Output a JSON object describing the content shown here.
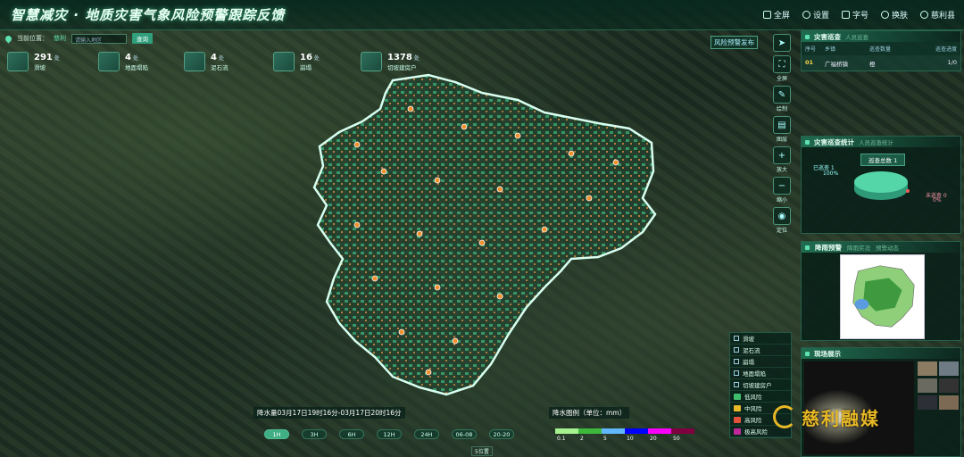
{
  "header": {
    "title": "智慧减灾 · 地质灾害气象风险预警跟踪反馈",
    "menu": [
      {
        "label": "全屏",
        "icon": "fullscreen-icon"
      },
      {
        "label": "设置",
        "icon": "gear-icon"
      },
      {
        "label": "字号",
        "icon": "font-size-icon"
      },
      {
        "label": "换肤",
        "icon": "palette-icon"
      },
      {
        "label": "慈利县",
        "icon": "user-icon"
      }
    ]
  },
  "location": {
    "label": "当前位置：",
    "value": "慈利",
    "placeholder": "请输入地区",
    "search_label": "查询"
  },
  "stats": [
    {
      "value": "291",
      "unit": "处",
      "label": "滑坡",
      "icon": "landslide-icon"
    },
    {
      "value": "4",
      "unit": "处",
      "label": "地面塌陷",
      "icon": "ground-collapse-icon"
    },
    {
      "value": "4",
      "unit": "处",
      "label": "泥石流",
      "icon": "debris-flow-icon"
    },
    {
      "value": "16",
      "unit": "处",
      "label": "崩塌",
      "icon": "rockfall-icon"
    },
    {
      "value": "1378",
      "unit": "处",
      "label": "切坡建房户",
      "icon": "house-icon"
    }
  ],
  "map": {
    "publish_label": "风险预警发布"
  },
  "tools": [
    {
      "label": "",
      "icon": "compass-icon"
    },
    {
      "label": "全屏",
      "icon": "expand-icon"
    },
    {
      "label": "绘制",
      "icon": "draw-icon"
    },
    {
      "label": "图层",
      "icon": "layers-icon"
    },
    {
      "label": "放大",
      "icon": "zoom-in-icon"
    },
    {
      "label": "缩小",
      "icon": "zoom-out-icon"
    },
    {
      "label": "定位",
      "icon": "location-icon"
    }
  ],
  "panel_tracking": {
    "title": "灾害巡查",
    "subtitle": "人员巡查",
    "columns": [
      "序号",
      "乡镇",
      "巡查数量",
      "巡查进度"
    ],
    "rows": [
      {
        "idx": "01",
        "town": "广福桥镇",
        "count": "橙",
        "progress": "1/0"
      }
    ]
  },
  "panel_stats": {
    "title": "灾害巡查统计",
    "subtitle": "人员巡查统计",
    "total": "巡查总数 1",
    "slices": [
      {
        "label": "已巡查 1",
        "pct": "100%",
        "value": 100,
        "color": "#55d6a8"
      },
      {
        "label": "未巡查 0",
        "pct": "0%",
        "value": 0,
        "color": "#f05a5a"
      }
    ]
  },
  "panel_warning": {
    "title": "降雨预警",
    "tabs": [
      "降雨实况",
      "预警动态"
    ]
  },
  "panel_video": {
    "title": "现场展示"
  },
  "layers": [
    {
      "label": "滑坡",
      "color": ""
    },
    {
      "label": "泥石流",
      "color": ""
    },
    {
      "label": "崩塌",
      "color": ""
    },
    {
      "label": "地面塌陷",
      "color": ""
    },
    {
      "label": "切坡建房户",
      "color": ""
    },
    {
      "label": "低风险",
      "color": "#3fbf6c"
    },
    {
      "label": "中风险",
      "color": "#e6b82a"
    },
    {
      "label": "高风险",
      "color": "#e0533a"
    },
    {
      "label": "极高风险",
      "color": "#c0289a"
    }
  ],
  "timeline": {
    "caption": "降水量03月17日19时16分-03月17日20时16分",
    "buttons": [
      "1H",
      "3H",
      "6H",
      "12H",
      "24H",
      "06-08",
      "20-20"
    ],
    "active": 0,
    "position_label": "5位置"
  },
  "rain_legend": {
    "title": "降水图例（单位：mm）",
    "stops": [
      {
        "label": "0.1",
        "color": "#a6f28f"
      },
      {
        "label": "2",
        "color": "#3db83d"
      },
      {
        "label": "5",
        "color": "#61b8ff"
      },
      {
        "label": "10",
        "color": "#0000fe"
      },
      {
        "label": "20",
        "color": "#fa00fa"
      },
      {
        "label": "50",
        "color": "#800040"
      }
    ]
  },
  "watermark": "慈利融媒"
}
